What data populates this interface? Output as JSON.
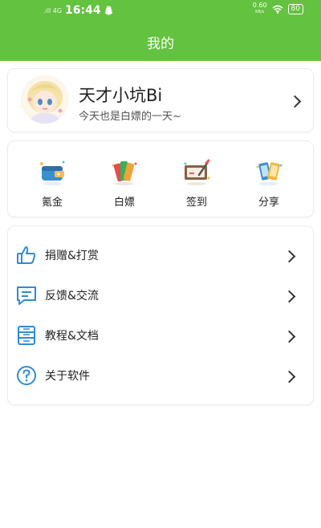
{
  "status_bar": {
    "signal_text": ".ıll 4G",
    "time": "16:44",
    "net_speed_value": "0.60",
    "net_speed_unit": "KB/s",
    "battery": "80"
  },
  "header": {
    "title": "我的"
  },
  "profile": {
    "name": "天才小坑Bi",
    "subtitle": "今天也是白嫖的一天~"
  },
  "actions": [
    {
      "label": "氪金",
      "icon": "wallet-icon"
    },
    {
      "label": "白嫖",
      "icon": "cards-icon"
    },
    {
      "label": "签到",
      "icon": "sign-board-icon"
    },
    {
      "label": "分享",
      "icon": "share-phones-icon"
    }
  ],
  "menu": [
    {
      "label": "捐赠&打赏",
      "icon": "thumbs-up-icon"
    },
    {
      "label": "反馈&交流",
      "icon": "chat-icon"
    },
    {
      "label": "教程&文档",
      "icon": "document-icon"
    },
    {
      "label": "关于软件",
      "icon": "help-icon"
    }
  ],
  "colors": {
    "primary": "#63c23f",
    "icon_blue": "#2e8bd6"
  }
}
